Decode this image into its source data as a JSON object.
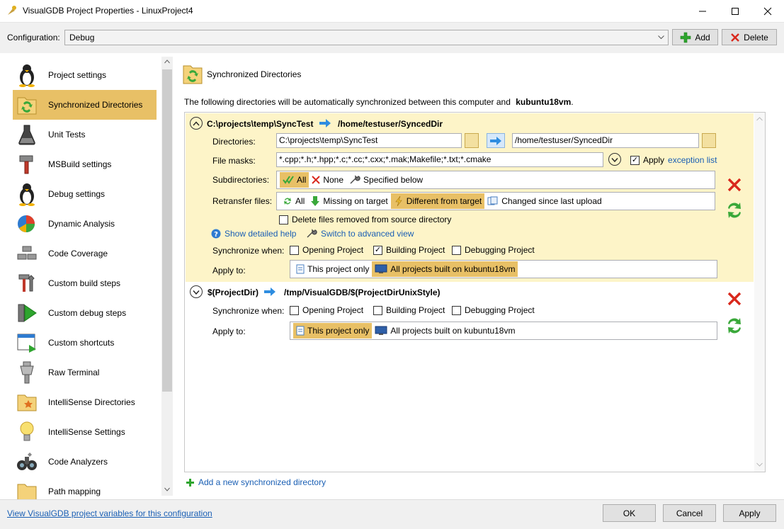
{
  "window": {
    "title": "VisualGDB Project Properties - LinuxProject4",
    "controls": [
      "minimize-icon",
      "maximize-icon",
      "close-icon"
    ]
  },
  "config": {
    "label": "Configuration:",
    "value": "Debug",
    "add_label": "Add",
    "delete_label": "Delete"
  },
  "sidebar": {
    "items": [
      {
        "label": "Project settings",
        "icon": "linux-penguin-icon"
      },
      {
        "label": "Synchronized Directories",
        "icon": "sync-folder-icon",
        "selected": true
      },
      {
        "label": "Unit Tests",
        "icon": "flask-icon"
      },
      {
        "label": "MSBuild settings",
        "icon": "hammer-icon"
      },
      {
        "label": "Debug settings",
        "icon": "linux-penguin-icon"
      },
      {
        "label": "Dynamic Analysis",
        "icon": "pie-chart-icon"
      },
      {
        "label": "Code Coverage",
        "icon": "blocks-icon"
      },
      {
        "label": "Custom build steps",
        "icon": "tools-icon"
      },
      {
        "label": "Custom debug steps",
        "icon": "play-icon"
      },
      {
        "label": "Custom shortcuts",
        "icon": "window-shortcut-icon"
      },
      {
        "label": "Raw Terminal",
        "icon": "serial-plug-icon"
      },
      {
        "label": "IntelliSense Directories",
        "icon": "folder-star-icon"
      },
      {
        "label": "IntelliSense Settings",
        "icon": "lightbulb-icon"
      },
      {
        "label": "Code Analyzers",
        "icon": "binoculars-icon"
      },
      {
        "label": "Path mapping",
        "icon": "folder-icon"
      }
    ]
  },
  "main": {
    "header": "Synchronized Directories",
    "intro_text": "The following directories will be automatically synchronized between this computer and",
    "remote_host": "kubuntu18vm",
    "intro_end": ".",
    "entry1": {
      "local": "C:\\projects\\temp\\SyncTest",
      "remote": "/home/testuser/SyncedDir",
      "directories_label": "Directories:",
      "local_input": "C:\\projects\\temp\\SyncTest",
      "remote_input": "/home/testuser/SyncedDir",
      "file_masks_label": "File masks:",
      "file_masks": "*.cpp;*.h;*.hpp;*.c;*.cc;*.cxx;*.mak;Makefile;*.txt;*.cmake",
      "apply_label": "Apply",
      "exception_list": "exception list",
      "subdirectories_label": "Subdirectories:",
      "subdir_options": [
        "All",
        "None",
        "Specified below"
      ],
      "retransfer_label": "Retransfer files:",
      "retransfer_options": [
        "All",
        "Missing on target",
        "Different from target",
        "Changed since last upload"
      ],
      "delete_files_label": "Delete files removed from source directory",
      "detailed_help": "Show detailed help",
      "advanced_view": "Switch to advanced view",
      "sync_when_label": "Synchronize when:",
      "sync_opening": "Opening Project",
      "sync_building": "Building Project",
      "sync_debugging": "Debugging Project",
      "apply_to_label": "Apply to:",
      "apply_this": "This project only",
      "apply_all": "All projects built on kubuntu18vm"
    },
    "entry2": {
      "local": "$(ProjectDir)",
      "remote": "/tmp/VisualGDB/$(ProjectDirUnixStyle)",
      "sync_when_label": "Synchronize when:",
      "sync_opening": "Opening Project",
      "sync_building": "Building Project",
      "sync_debugging": "Debugging Project",
      "apply_to_label": "Apply to:",
      "apply_this": "This project only",
      "apply_all": "All projects built on kubuntu18vm"
    },
    "add_new": "Add a new synchronized directory"
  },
  "footer": {
    "vars_link": "View VisualGDB project variables for this configuration",
    "ok": "OK",
    "cancel": "Cancel",
    "apply": "Apply"
  },
  "colors": {
    "selected": "#e8c066",
    "entry_bg": "#fdf4c8",
    "link": "#1a5fb4",
    "arrow_blue": "#2e8de0",
    "delete_red": "#d9281c",
    "add_green": "#2ea52e"
  }
}
